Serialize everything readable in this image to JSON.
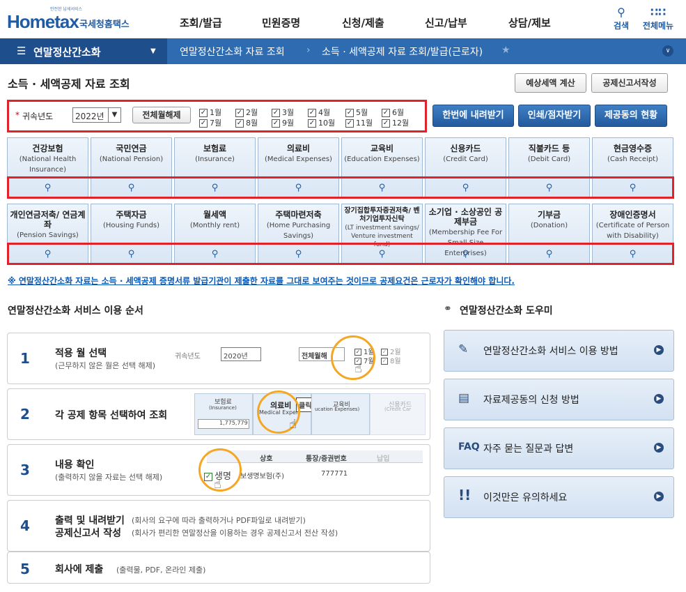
{
  "header": {
    "logo_sub": "안전한 납세서비스",
    "logo_main": "Hometax",
    "logo_kr": "국세청홈택스",
    "nav": [
      "조회/발급",
      "민원증명",
      "신청/제출",
      "신고/납부",
      "상담/제보"
    ],
    "search_label": "검색",
    "menu_label": "전체메뉴"
  },
  "breadcrumb": {
    "section": "연말정산간소화",
    "level2": "연말정산간소화 자료 조회",
    "level3": "소득 · 세액공제 자료 조회/발급(근로자)"
  },
  "page": {
    "title": "소득 · 세액공제 자료 조회",
    "btn_estimate": "예상세액 계산",
    "btn_report": "공제신고서작성"
  },
  "filter": {
    "label": "귀속년도",
    "year": "2022년",
    "clear_all": "전체월해제",
    "months": [
      "1월",
      "2월",
      "3월",
      "4월",
      "5월",
      "6월",
      "7월",
      "8월",
      "9월",
      "10월",
      "11월",
      "12월"
    ]
  },
  "actions": {
    "download_all": "한번에 내려받기",
    "print": "인쇄/점자받기",
    "status": "제공동의 현황"
  },
  "cards_row1": [
    {
      "ko": "건강보험",
      "en": "(National Health Insurance)"
    },
    {
      "ko": "국민연금",
      "en": "(National Pension)"
    },
    {
      "ko": "보험료",
      "en": "(Insurance)"
    },
    {
      "ko": "의료비",
      "en": "(Medical Expenses)"
    },
    {
      "ko": "교육비",
      "en": "(Education Expenses)"
    },
    {
      "ko": "신용카드",
      "en": "(Credit Card)"
    },
    {
      "ko": "직불카드 등",
      "en": "(Debit Card)"
    },
    {
      "ko": "현금영수증",
      "en": "(Cash Receipt)"
    }
  ],
  "cards_row2": [
    {
      "ko": "개인연금저축/ 연금계좌",
      "en": "(Pension Savings)"
    },
    {
      "ko": "주택자금",
      "en": "(Housing Funds)"
    },
    {
      "ko": "월세액",
      "en": "(Monthly rent)"
    },
    {
      "ko": "주택마련저축",
      "en": "(Home Purchasing Savings)"
    },
    {
      "ko": "장기집합투자증권저축/ 벤처기업투자신탁",
      "en": "(LT investment savings/ Venture investment fund)"
    },
    {
      "ko": "소기업 · 소상공인 공제부금",
      "en": "(Membership Fee For Small Size Enterprises)"
    },
    {
      "ko": "기부금",
      "en": "(Donation)"
    },
    {
      "ko": "장애인증명서",
      "en": "(Certificate of Person with Disability)"
    }
  ],
  "notice": "※ 연말정산간소화 자료는 소득 · 세액공제 증명서류 발급기관이 제출한 자료를 그대로 보여주는 것이므로 공제요건은 근로자가 확인해야 합니다.",
  "steps_title": "연말정산간소화 서비스 이용 순서",
  "steps": [
    {
      "num": "1",
      "title": "적용 월 선택",
      "desc": "(근무하지 않은 월은 선택 해제)"
    },
    {
      "num": "2",
      "title": "각 공제 항목 선택하여 조회",
      "desc": ""
    },
    {
      "num": "3",
      "title": "내용 확인",
      "desc": "(출력하지 않을 자료는 선택 해제)"
    },
    {
      "num": "4",
      "title": "출력 및 내려받기",
      "desc": "(회사의 요구에 따라 출력하거나 PDF파일로 내려받기)",
      "title2": "공제신고서 작성",
      "desc2": "(회사가 편리한 연말정산을 이용하는 경우 공제신고서 전산 작성)"
    },
    {
      "num": "5",
      "title": "회사에 제출",
      "desc": "(출력물, PDF, 온라인 제출)"
    }
  ],
  "step_mock": {
    "s1_label": "귀속년도",
    "s1_year": "2020년",
    "s1_clear": "전체월해",
    "s1_m1": "1월",
    "s1_m2": "2월",
    "s1_m7": "7월",
    "s1_m8": "8월",
    "s2_ins": "보험료",
    "s2_ins_en": "(Insurance)",
    "s2_value": "1,775,779",
    "s2_med": "의료비",
    "s2_med_en": "Medical Expen",
    "s2_click": "클릭!",
    "s2_edu": "교육비",
    "s2_edu_en": "ucation Expenses)",
    "s2_card": "신용카드",
    "s2_card_en": "(Credit Car",
    "s3_col1": "상호",
    "s3_col2": "통장/증권번호",
    "s3_col3": "납입",
    "s3_row1": "보생명보험(주)",
    "s3_row1_no": "777771",
    "s3_row1_name": "생명"
  },
  "help_title": "연말정산간소화 도우미",
  "help_items": [
    {
      "icon": "document-edit-icon",
      "label": "연말정산간소화 서비스 이용 방법"
    },
    {
      "icon": "document-icon",
      "label": "자료제공동의 신청 방법"
    },
    {
      "icon": "faq-icon",
      "label": "자주 묻는 질문과 답변",
      "badge": "FAQ"
    },
    {
      "icon": "exclamation-icon",
      "label": "이것만은 유의하세요"
    }
  ]
}
